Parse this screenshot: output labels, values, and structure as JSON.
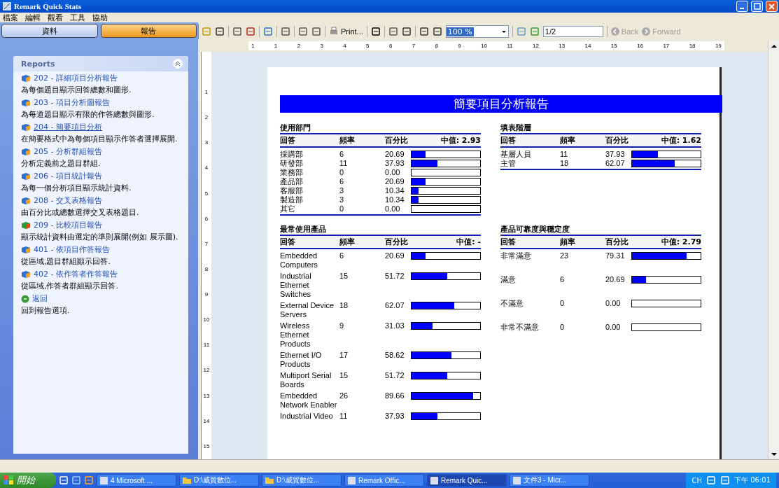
{
  "window": {
    "title": "Remark Quick Stats"
  },
  "menu": [
    "檔案",
    "編輯",
    "觀看",
    "工具",
    "協助"
  ],
  "side_tabs": [
    {
      "label": "資料",
      "selected": false
    },
    {
      "label": "報告",
      "selected": true
    }
  ],
  "reports_panel": {
    "title": "Reports",
    "items": [
      {
        "kind": "report",
        "link": "202 - 詳細項目分析報告",
        "description": "為每個題目顯示回答總數和圖形.",
        "selected": false
      },
      {
        "kind": "report",
        "link": "203 - 項目分析圖報告",
        "description": "為每道題目顯示有限的作答總數與圖形.",
        "selected": false
      },
      {
        "kind": "report",
        "link": "204 - 簡要項目分析",
        "description": "在簡要格式中為每個項目顯示作答者選擇展開.",
        "selected": true
      },
      {
        "kind": "report",
        "link": "205 - 分析群組報告",
        "description": "分析定義前之題目群組.",
        "selected": false
      },
      {
        "kind": "report",
        "link": "206 - 項目統計報告",
        "description": "為每一個分析項目顯示統計資料.",
        "selected": false
      },
      {
        "kind": "report",
        "link": "208 - 交叉表格報告",
        "description": "由百分比或總數選擇交叉表格題目.",
        "selected": false
      },
      {
        "kind": "compare",
        "link": "209 - 比較項目報告",
        "description": "顯示統計資料由選定的準則展開(例如 展示圖).",
        "selected": false
      },
      {
        "kind": "report",
        "link": "401 - 依項目作答報告",
        "description": "從區域,題目群組顯示回答.",
        "selected": false
      },
      {
        "kind": "report",
        "link": "402 - 依作答者作答報告",
        "description": "從區域,作答者群組顯示回答.",
        "selected": false
      },
      {
        "kind": "back",
        "link": "返回",
        "description": "回到報告選項.",
        "selected": false
      }
    ]
  },
  "toolbar": {
    "print": "Print...",
    "zoom": "100 %",
    "page": "1/2",
    "back": {
      "label": "Back",
      "disabled": true
    },
    "forward": {
      "label": "Forward",
      "disabled": true
    }
  },
  "ruler": {
    "horizontal": [
      "1",
      "1",
      "2",
      "3",
      "4",
      "5",
      "6",
      "7",
      "8",
      "9",
      "10",
      "11",
      "12",
      "13",
      "14",
      "15",
      "16",
      "17",
      "18",
      "19"
    ],
    "vertical": [
      "1",
      "2",
      "3",
      "4",
      "5",
      "6",
      "7",
      "8",
      "9",
      "10",
      "11",
      "12",
      "13",
      "14",
      "15"
    ]
  },
  "report": {
    "title": "簡要項目分析報告",
    "sections": [
      {
        "title": "使用部門",
        "columns": [
          "回答",
          "頻率",
          "百分比"
        ],
        "median": "中值: 2.93",
        "rows": [
          {
            "answer": "採購部",
            "frequency": "6",
            "percent": "20.69",
            "level": 0.2069
          },
          {
            "answer": "研發部",
            "frequency": "11",
            "percent": "37.93",
            "level": 0.3793
          },
          {
            "answer": "業務部",
            "frequency": "0",
            "percent": "0.00",
            "level": 0
          },
          {
            "answer": "產品部",
            "frequency": "6",
            "percent": "20.69",
            "level": 0.2069
          },
          {
            "answer": "客服部",
            "frequency": "3",
            "percent": "10.34",
            "level": 0.1034
          },
          {
            "answer": "製造部",
            "frequency": "3",
            "percent": "10.34",
            "level": 0.1034
          },
          {
            "answer": "其它",
            "frequency": "0",
            "percent": "0.00",
            "level": 0
          }
        ]
      },
      {
        "title": "填表階層",
        "columns": [
          "回答",
          "頻率",
          "百分比"
        ],
        "median": "中值: 1.62",
        "rows": [
          {
            "answer": "基層人員",
            "frequency": "11",
            "percent": "37.93",
            "level": 0.3793
          },
          {
            "answer": "主管",
            "frequency": "18",
            "percent": "62.07",
            "level": 0.6207
          }
        ]
      },
      {
        "title": "最常使用產品",
        "columns": [
          "回答",
          "頻率",
          "百分比"
        ],
        "median": "中值: -",
        "rows": [
          {
            "answer": "Embedded Computers",
            "frequency": "6",
            "percent": "20.69",
            "level": 0.2069
          },
          {
            "answer": "Industrial Ethernet Switches",
            "frequency": "15",
            "percent": "51.72",
            "level": 0.5172
          },
          {
            "answer": "External Device Servers",
            "frequency": "18",
            "percent": "62.07",
            "level": 0.6207
          },
          {
            "answer": "Wireless Ethernet Products",
            "frequency": "9",
            "percent": "31.03",
            "level": 0.3103
          },
          {
            "answer": "Ethernet I/O Products",
            "frequency": "17",
            "percent": "58.62",
            "level": 0.5862
          },
          {
            "answer": "Multiport Serial Boards",
            "frequency": "15",
            "percent": "51.72",
            "level": 0.5172
          },
          {
            "answer": "Embedded Network Enabler",
            "frequency": "26",
            "percent": "89.66",
            "level": 0.8966
          },
          {
            "answer": "Industrial Video",
            "frequency": "11",
            "percent": "37.93",
            "level": 0.3793
          }
        ]
      },
      {
        "title": "產品可靠度與穩定度",
        "columns": [
          "回答",
          "頻率",
          "百分比"
        ],
        "median": "中值: 2.79",
        "rows": [
          {
            "answer": "非常滿意",
            "frequency": "23",
            "percent": "79.31",
            "level": 0.7931
          },
          {
            "answer": "滿意",
            "frequency": "6",
            "percent": "20.69",
            "level": 0.2069
          },
          {
            "answer": "不滿意",
            "frequency": "0",
            "percent": "0.00",
            "level": 0
          },
          {
            "answer": "非常不滿意",
            "frequency": "0",
            "percent": "0.00",
            "level": 0
          }
        ]
      }
    ]
  },
  "taskbar": {
    "start": "開始",
    "tasks": [
      {
        "kind": "app",
        "label": "4 Microsoft ...",
        "selected": false
      },
      {
        "kind": "folder",
        "label": "D:\\威貿數位...",
        "selected": false
      },
      {
        "kind": "folder",
        "label": "D:\\威貿數位...",
        "selected": false
      },
      {
        "kind": "app",
        "label": "Remark Offic...",
        "selected": false
      },
      {
        "kind": "app",
        "label": "Remark Quic...",
        "selected": true
      },
      {
        "kind": "app",
        "label": "文件3 - Micr...",
        "selected": false
      }
    ],
    "language": "CH",
    "clock": "下午 06:01"
  }
}
